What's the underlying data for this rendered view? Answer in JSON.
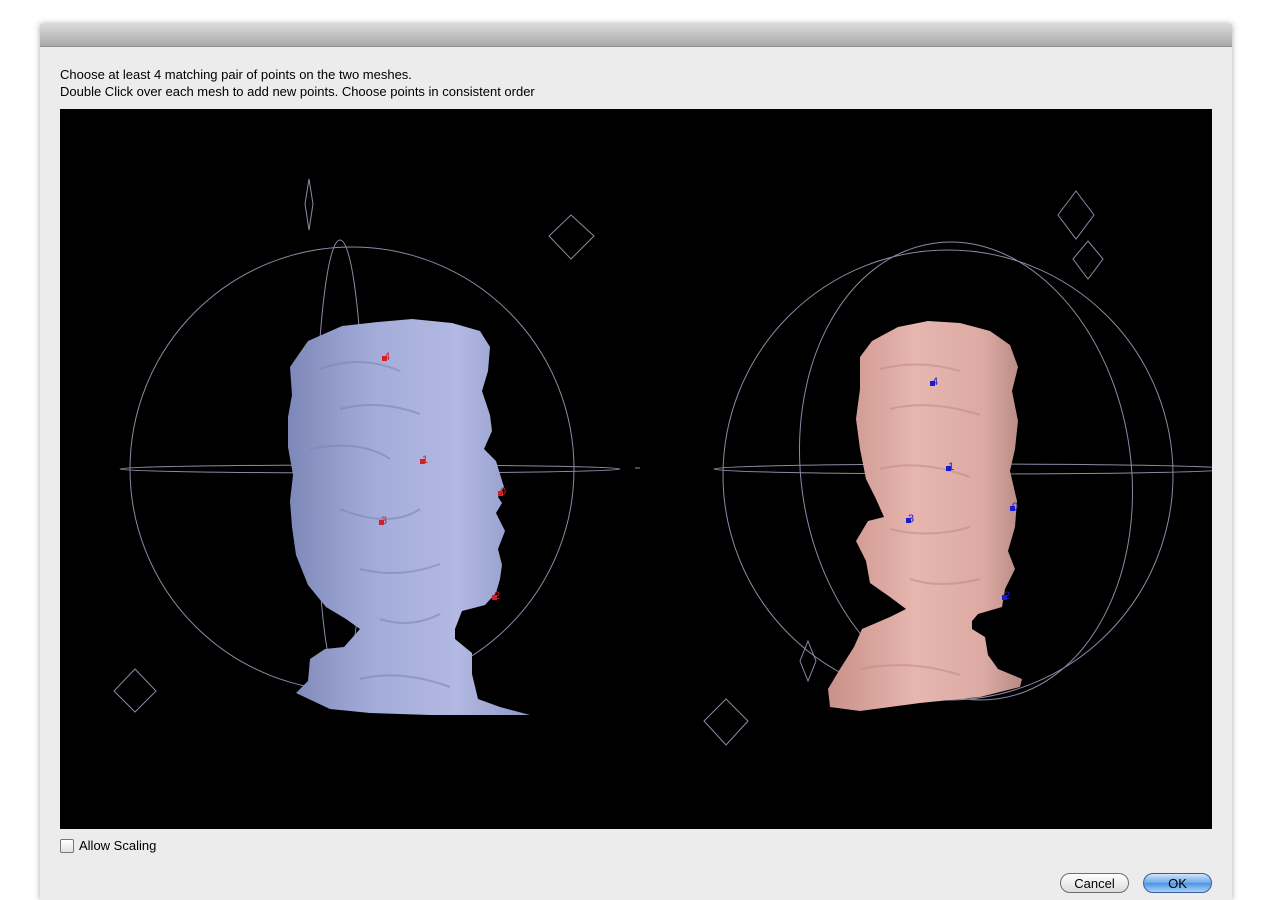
{
  "instructions": {
    "line1": "Choose at least 4 matching pair of points on the two meshes.",
    "line2": "Double Click over each mesh to add new points. Choose points in consistent order"
  },
  "left_mesh": {
    "color": "#a3acd9",
    "marker_color": "#d42020",
    "points": [
      "4",
      "1",
      "0",
      "3",
      "2"
    ]
  },
  "right_mesh": {
    "color": "#dfaaa3",
    "marker_color": "#1a1ad0",
    "points": [
      "4",
      "1",
      "0",
      "3",
      "2"
    ]
  },
  "options": {
    "allow_scaling_label": "Allow Scaling",
    "allow_scaling_checked": false
  },
  "buttons": {
    "cancel": "Cancel",
    "ok": "OK"
  },
  "colors": {
    "gizmo": "#8a8aa6",
    "viewport_bg": "#000000",
    "ok_button": "#5a9de6"
  }
}
